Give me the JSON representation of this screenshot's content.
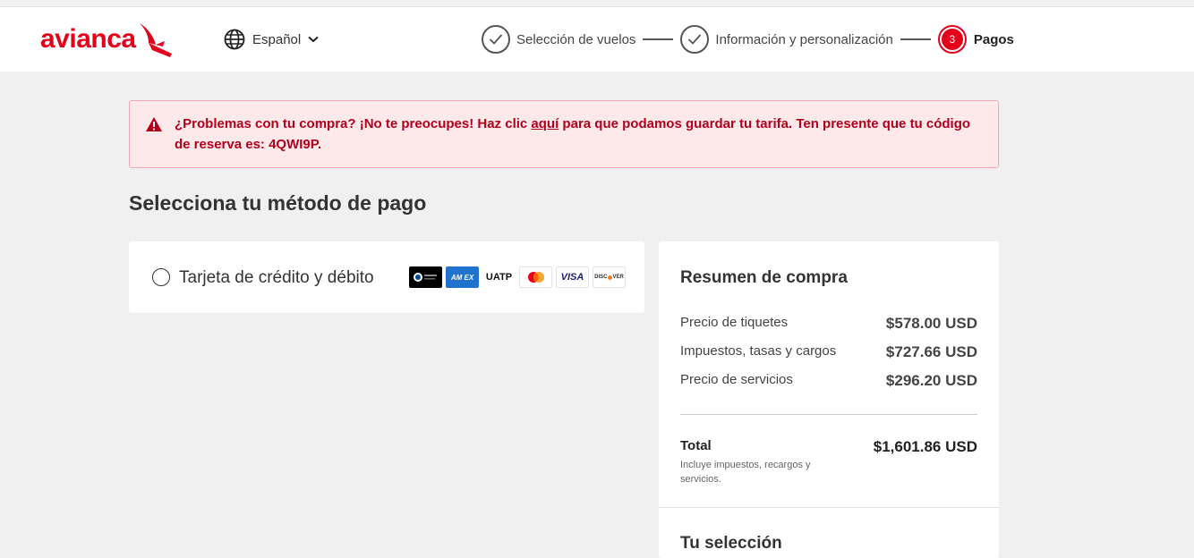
{
  "header": {
    "logo_text": "avianca",
    "language": "Español",
    "steps": [
      {
        "label": "Selección de vuelos",
        "state": "done"
      },
      {
        "label": "Información y personalización",
        "state": "done"
      },
      {
        "number": "3",
        "label": "Pagos",
        "state": "active"
      }
    ]
  },
  "alert": {
    "text_before": "¿Problemas con tu compra? ¡No te preocupes! Haz clic ",
    "link": "aquí",
    "text_after": " para que podamos guardar tu tarifa. Ten presente que tu código de reserva es: 4QWI9P.",
    "icon": "warning-icon",
    "color": "#b3001b"
  },
  "payment": {
    "title": "Selecciona tu método de pago",
    "option_label": "Tarjeta de crédito y débito",
    "brands": [
      "Diners Club",
      "AMEX",
      "UATP",
      "Mastercard",
      "VISA",
      "DISCOVER"
    ]
  },
  "summary": {
    "title": "Resumen de compra",
    "rows": [
      {
        "label": "Precio de tiquetes",
        "value": "$578.00 USD"
      },
      {
        "label": "Impuestos, tasas y cargos",
        "value": "$727.66 USD"
      },
      {
        "label": "Precio de servicios",
        "value": "$296.20 USD"
      }
    ],
    "total_label": "Total",
    "total_value": "$1,601.86 USD",
    "total_note": "Incluye impuestos, recargos y servicios.",
    "selection_title": "Tu selección"
  },
  "colors": {
    "brand": "#e4001b",
    "background": "#f0f0f0"
  }
}
